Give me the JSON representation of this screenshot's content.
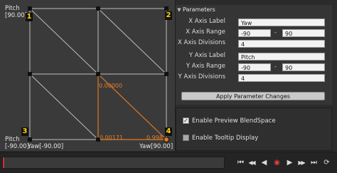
{
  "grid": {
    "y_axis_label": "Pitch",
    "y_max_label": "[90.00]",
    "y_min_label_top": "Pitch",
    "y_min_label": "[-90.00]",
    "x_min_label": "Yaw[-90.00]",
    "x_max_label": "Yaw[90.00]",
    "corners": [
      "1",
      "2",
      "3",
      "4"
    ],
    "samples": [
      {
        "label": "0.00000"
      },
      {
        "label": "0.00171"
      },
      {
        "label": "0.998"
      }
    ],
    "colors": {
      "grid_line": "#c8c8c8",
      "selection": "#e07a20",
      "point": "#111111"
    }
  },
  "parameters": {
    "header": "Parameters",
    "x_axis_label_caption": "X Axis Label",
    "x_axis_label_value": "Yaw",
    "x_axis_range_caption": "X Axis Range",
    "x_axis_range_min": "-90",
    "x_axis_range_max": "90",
    "x_axis_divisions_caption": "X Axis Divisions",
    "x_axis_divisions_value": "4",
    "y_axis_label_caption": "Y Axis Label",
    "y_axis_label_value": "Pitch",
    "y_axis_range_caption": "Y Axis Range",
    "y_axis_range_min": "-90",
    "y_axis_range_max": "90",
    "y_axis_divisions_caption": "Y Axis Divisions",
    "y_axis_divisions_value": "4",
    "range_separator": "-",
    "apply_button": "Apply Parameter Changes"
  },
  "options": {
    "enable_preview": {
      "label": "Enable Preview BlendSpace",
      "checked": true
    },
    "enable_tooltip": {
      "label": "Enable Tooltip Display",
      "checked": false
    }
  },
  "timeline": {
    "buttons": [
      {
        "icon": "skip-to-start-icon",
        "glyph": "⏮"
      },
      {
        "icon": "step-back-icon",
        "glyph": "◀◀"
      },
      {
        "icon": "play-reverse-icon",
        "glyph": "◀"
      },
      {
        "icon": "record-icon",
        "glyph": "◉"
      },
      {
        "icon": "play-icon",
        "glyph": "▶"
      },
      {
        "icon": "step-forward-icon",
        "glyph": "▶▶"
      },
      {
        "icon": "skip-to-end-icon",
        "glyph": "⏭"
      },
      {
        "icon": "loop-icon",
        "glyph": "⟳"
      }
    ]
  }
}
